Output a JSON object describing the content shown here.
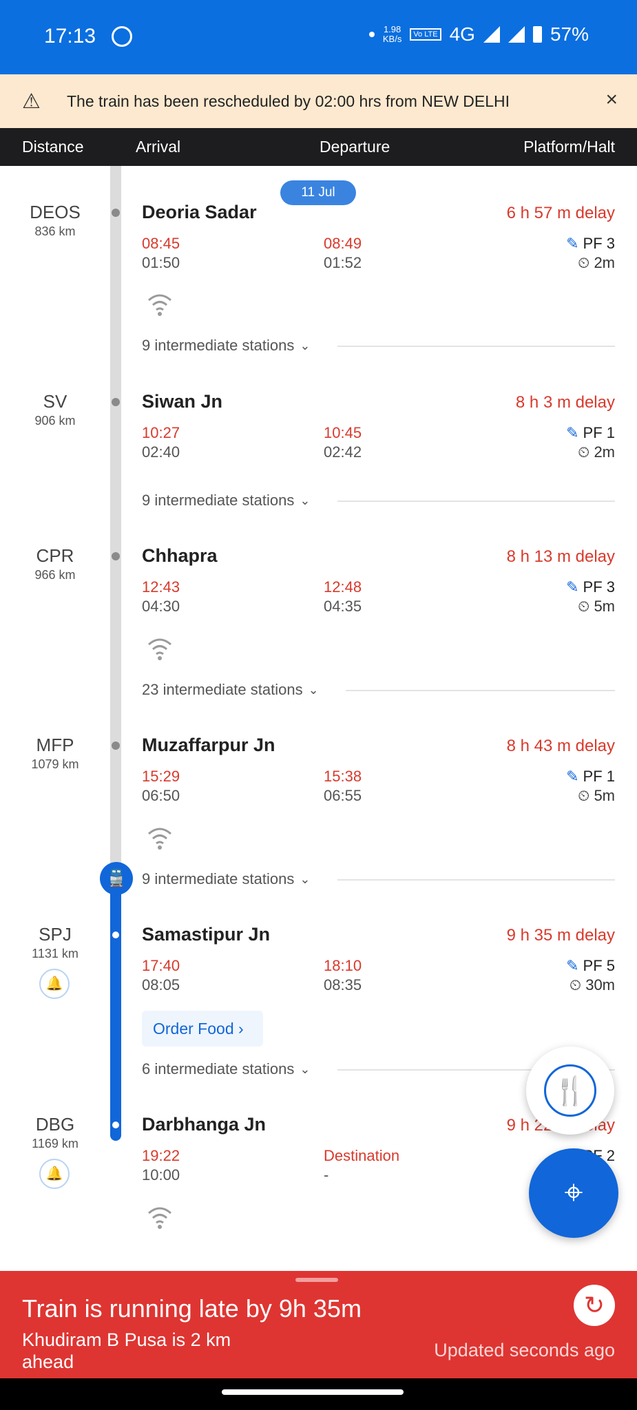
{
  "status_bar": {
    "time": "17:13",
    "speed": "1.98",
    "speed_unit": "KB/s",
    "volte": "Vo LTE",
    "network": "4G",
    "battery": "57%"
  },
  "alert": {
    "message": "The train has been rescheduled by 02:00 hrs from NEW DELHI",
    "close": "×"
  },
  "columns": {
    "distance": "Distance",
    "arrival": "Arrival",
    "departure": "Departure",
    "platform": "Platform/Halt"
  },
  "date_pill": "11 Jul",
  "stations": [
    {
      "code": "DEOS",
      "dist": "836 km",
      "name": "Deoria Sadar",
      "delay": "6 h 57 m delay",
      "arr_actual": "08:45",
      "arr_sched": "01:50",
      "dep_actual": "08:49",
      "dep_sched": "01:52",
      "pf": "PF 3",
      "halt": "2m",
      "intermediate": "9 intermediate stations"
    },
    {
      "code": "SV",
      "dist": "906 km",
      "name": "Siwan Jn",
      "delay": "8 h 3 m delay",
      "arr_actual": "10:27",
      "arr_sched": "02:40",
      "dep_actual": "10:45",
      "dep_sched": "02:42",
      "pf": "PF 1",
      "halt": "2m",
      "intermediate": "9 intermediate stations"
    },
    {
      "code": "CPR",
      "dist": "966 km",
      "name": "Chhapra",
      "delay": "8 h 13 m delay",
      "arr_actual": "12:43",
      "arr_sched": "04:30",
      "dep_actual": "12:48",
      "dep_sched": "04:35",
      "pf": "PF 3",
      "halt": "5m",
      "intermediate": "23 intermediate stations"
    },
    {
      "code": "MFP",
      "dist": "1079 km",
      "name": "Muzaffarpur Jn",
      "delay": "8 h 43 m delay",
      "arr_actual": "15:29",
      "arr_sched": "06:50",
      "dep_actual": "15:38",
      "dep_sched": "06:55",
      "pf": "PF 1",
      "halt": "5m",
      "intermediate": "9 intermediate stations"
    },
    {
      "code": "SPJ",
      "dist": "1131 km",
      "name": "Samastipur Jn",
      "delay": "9 h 35 m delay",
      "arr_actual": "17:40",
      "arr_sched": "08:05",
      "dep_actual": "18:10",
      "dep_sched": "08:35",
      "pf": "PF 5",
      "halt": "30m",
      "intermediate": "6 intermediate stations"
    },
    {
      "code": "DBG",
      "dist": "1169 km",
      "name": "Darbhanga Jn",
      "delay": "9 h 22 m delay",
      "arr_actual": "19:22",
      "arr_sched": "10:00",
      "dep_actual": "Destination",
      "dep_sched": "-",
      "pf": "PF 2"
    }
  ],
  "order_food": "Order Food ›",
  "bottom": {
    "title": "Train is running late by 9h 35m",
    "sub": "Khudiram B Pusa is 2 km ahead",
    "updated": "Updated seconds  ago"
  },
  "icons": {
    "warning": "warning-icon",
    "close": "close-icon",
    "train": "train-icon",
    "wifi": "wifi-icon",
    "bell": "bell-icon",
    "pencil": "pencil-icon",
    "timer": "timer-off-icon",
    "food": "food-icon",
    "location": "location-icon",
    "refresh": "refresh-icon"
  }
}
